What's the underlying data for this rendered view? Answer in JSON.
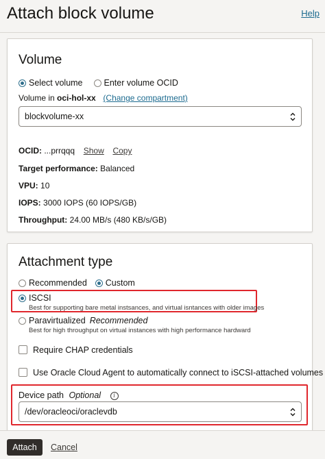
{
  "header": {
    "title": "Attach block volume",
    "help_label": "Help"
  },
  "volume": {
    "title": "Volume",
    "radio_select": "Select volume",
    "radio_ocid": "Enter volume OCID",
    "compartment_prefix": "Volume in",
    "compartment_name": "oci-hol-xx",
    "change_compartment": "(Change compartment)",
    "selected_volume": "blockvolume-xx",
    "ocid_label": "OCID:",
    "ocid_value": "...prrqqq",
    "show_label": "Show",
    "copy_label": "Copy",
    "perf_label": "Target performance:",
    "perf_value": "Balanced",
    "vpu_label": "VPU:",
    "vpu_value": "10",
    "iops_label": "IOPS:",
    "iops_value": "3000 IOPS (60 IOPS/GB)",
    "throughput_label": "Throughput:",
    "throughput_value": "24.00 MB/s (480 KB/s/GB)"
  },
  "attachment": {
    "title": "Attachment type",
    "radio_recommended": "Recommended",
    "radio_custom": "Custom",
    "iscsi_label": "ISCSI",
    "iscsi_help": "Best for supporting bare metal instsances, and virtual isntances with older images",
    "para_label": "Paravirtualized",
    "para_tag": "Recommended",
    "para_help": "Best for high throughput on virtual instances with high performance hardward",
    "chap_label": "Require CHAP credentials",
    "agent_label": "Use Oracle Cloud Agent to automatically connect to iSCSI-attached volumes",
    "device_label": "Device path",
    "device_optional": "Optional",
    "device_value": "/dev/oracleoci/oraclevdb"
  },
  "footer": {
    "attach_label": "Attach",
    "cancel_label": "Cancel"
  },
  "colors": {
    "accent": "#2d6e8c",
    "link": "#1b6a8f",
    "highlight": "#e0262c",
    "primary_button": "#312d2a"
  }
}
